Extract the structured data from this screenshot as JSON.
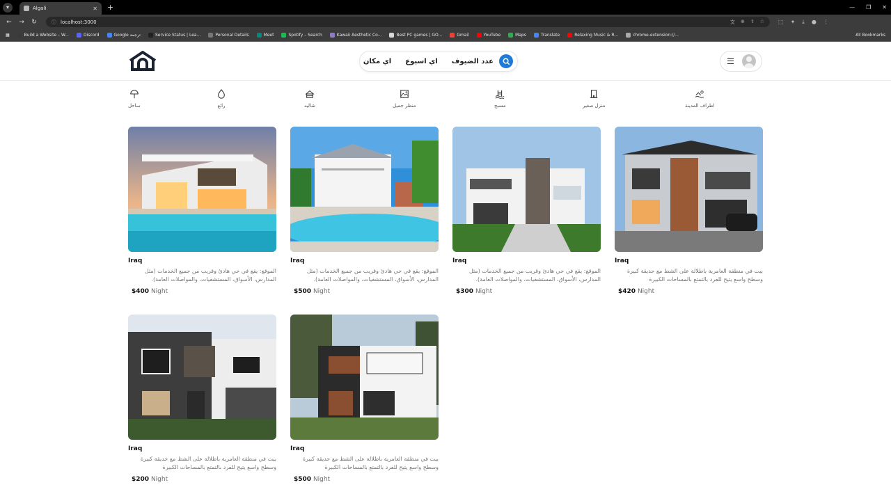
{
  "browser": {
    "tab_title": "Algali",
    "url": "localhost:3000",
    "bookmarks": [
      {
        "label": "Build a Website – W...",
        "color": "#3a3a3a"
      },
      {
        "label": "Discord",
        "color": "#5865f2"
      },
      {
        "label": "Google ترجمة",
        "color": "#4285f4"
      },
      {
        "label": "Service Status | Lea...",
        "color": "#222222"
      },
      {
        "label": "Personal Details",
        "color": "#777777"
      },
      {
        "label": "Meet",
        "color": "#00897b"
      },
      {
        "label": "Spotify – Search",
        "color": "#1db954"
      },
      {
        "label": "Kawaii Aesthetic Co...",
        "color": "#8e7cc3"
      },
      {
        "label": "Best PC games | GO...",
        "color": "#d9d9d9"
      },
      {
        "label": "Gmail",
        "color": "#ea4335"
      },
      {
        "label": "YouTube",
        "color": "#ff0000"
      },
      {
        "label": "Maps",
        "color": "#34a853"
      },
      {
        "label": "Translate",
        "color": "#4285f4"
      },
      {
        "label": "Relaxing Music & R...",
        "color": "#ff0000"
      },
      {
        "label": "chrome-extension://...",
        "color": "#aaaaaa"
      }
    ],
    "all_bookmarks": "All Bookmarks"
  },
  "header": {
    "search": {
      "guests": "عدد الضيوف",
      "week": "اي اسبوع",
      "place": "اي مكان"
    },
    "accent": "#1f7ad8"
  },
  "categories": [
    {
      "label": "ساحل",
      "icon": "beach-umbrella-icon"
    },
    {
      "label": "رائع",
      "icon": "drop-icon"
    },
    {
      "label": "شاليه",
      "icon": "chalet-icon"
    },
    {
      "label": "منظر جميل",
      "icon": "landscape-icon"
    },
    {
      "label": "مسبح",
      "icon": "pool-icon"
    },
    {
      "label": "منزل صغير",
      "icon": "small-house-icon"
    },
    {
      "label": "اطراف المدينة",
      "icon": "suburbs-icon"
    }
  ],
  "listings": [
    {
      "country": "Iraq",
      "desc": "الموقع: يقع في حي هادئ وقريب من جميع الخدمات (مثل المدارس، الأسواق، المستشفيات، والمواصلات العامة).",
      "price": "$400",
      "unit": "Night"
    },
    {
      "country": "Iraq",
      "desc": "الموقع: يقع في حي هادئ وقريب من جميع الخدمات (مثل المدارس، الأسواق، المستشفيات، والمواصلات العامة).",
      "price": "$500",
      "unit": "Night"
    },
    {
      "country": "Iraq",
      "desc": "الموقع: يقع في حي هادئ وقريب من جميع الخدمات (مثل المدارس، الأسواق، المستشفيات، والمواصلات العامة).",
      "price": "$300",
      "unit": "Night"
    },
    {
      "country": "Iraq",
      "desc": "بيت في منطقة العامرية باطلالة على الشط مع حديقة كبيرة وسطح واسع يتيح للفرد بالتمتع بالمساحات الكبيرة",
      "price": "$420",
      "unit": "Night"
    },
    {
      "country": "Iraq",
      "desc": "بيت في منطقة العامرية باطلالة على الشط مع حديقة كبيرة وسطح واسع يتيح للفرد بالتمتع بالمساحات الكبيرة",
      "price": "$200",
      "unit": "Night"
    },
    {
      "country": "Iraq",
      "desc": "بيت في منطقة العامرية باطلالة على الشط مع حديقة كبيرة وسطح واسع يتيح للفرد بالتمتع بالمساحات الكبيرة",
      "price": "$500",
      "unit": "Night"
    }
  ]
}
